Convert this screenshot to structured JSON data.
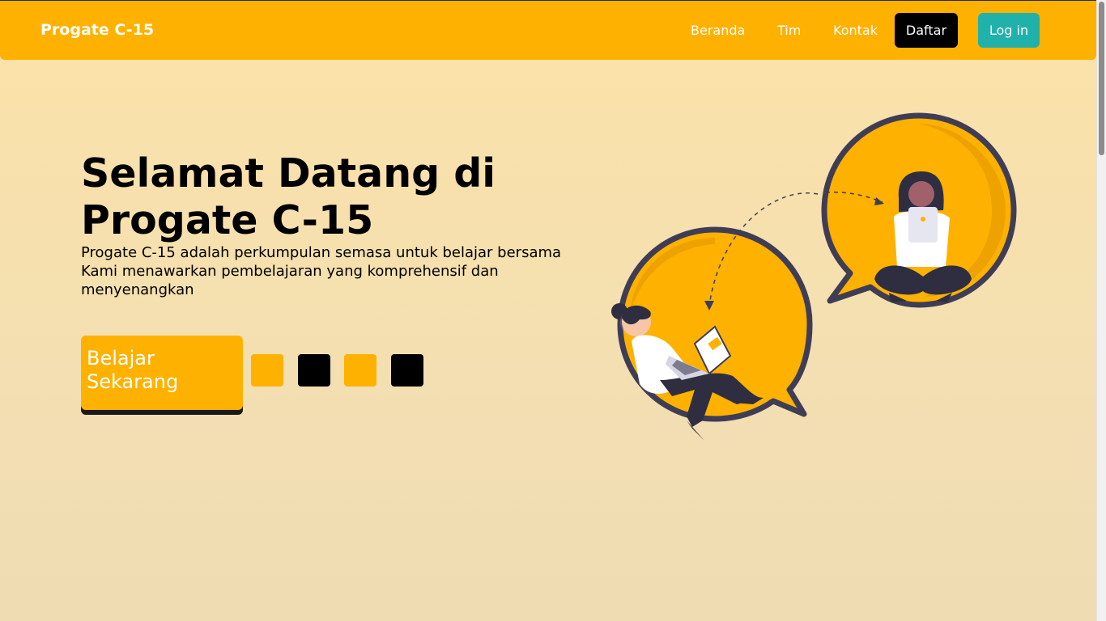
{
  "navbar": {
    "brand": "Progate C-15",
    "links": [
      "Beranda",
      "Tim",
      "Kontak"
    ],
    "signup_label": "Daftar",
    "login_label": "Log in"
  },
  "hero": {
    "title": "Selamat Datang di Progate C-15",
    "description_line1": "Progate C-15 adalah perkumpulan semasa untuk belajar bersama",
    "description_line2": "Kami menawarkan pembelajaran yang komprehensif dan menyenangkan",
    "cta_label": "Belajar Sekarang"
  },
  "colors": {
    "accent": "#ffb100",
    "login": "#20b2aa",
    "dark": "#000000",
    "background": "#fce2a8"
  },
  "decor": {
    "squares": [
      "yellow",
      "black",
      "yellow",
      "black"
    ]
  },
  "illustration": {
    "icons": [
      "speech-bubble-icon",
      "person-laptop-icon",
      "person-tablet-icon"
    ]
  }
}
